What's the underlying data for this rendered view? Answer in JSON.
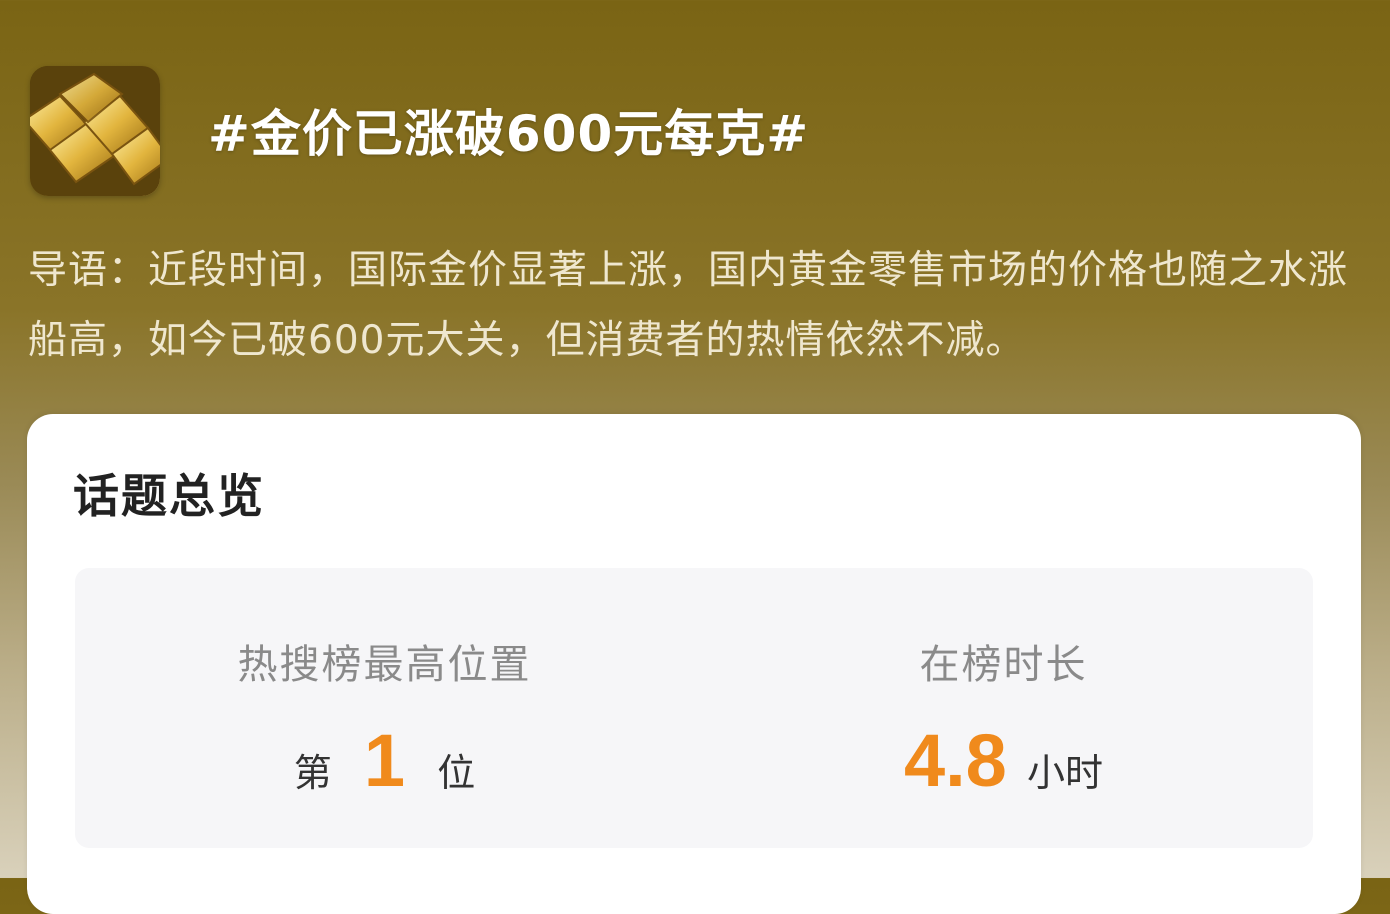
{
  "topic": {
    "title": "#金价已涨破600元每克#",
    "intro": "导语：近段时间，国际金价显著上涨，国内黄金零售市场的价格也随之水涨船高，如今已破600元大关，但消费者的热情依然不减。",
    "thumbnail_icon": "gold-bars-icon"
  },
  "overview": {
    "title": "话题总览",
    "stats": {
      "rank": {
        "label": "热搜榜最高位置",
        "prefix": "第",
        "value": "1",
        "suffix": "位"
      },
      "duration": {
        "label": "在榜时长",
        "value": "4.8",
        "unit": "小时"
      }
    }
  },
  "colors": {
    "accent": "#f08a1c",
    "header_gold": "#7a6414",
    "card_bg": "#ffffff",
    "stats_bg": "#f6f6f8"
  }
}
